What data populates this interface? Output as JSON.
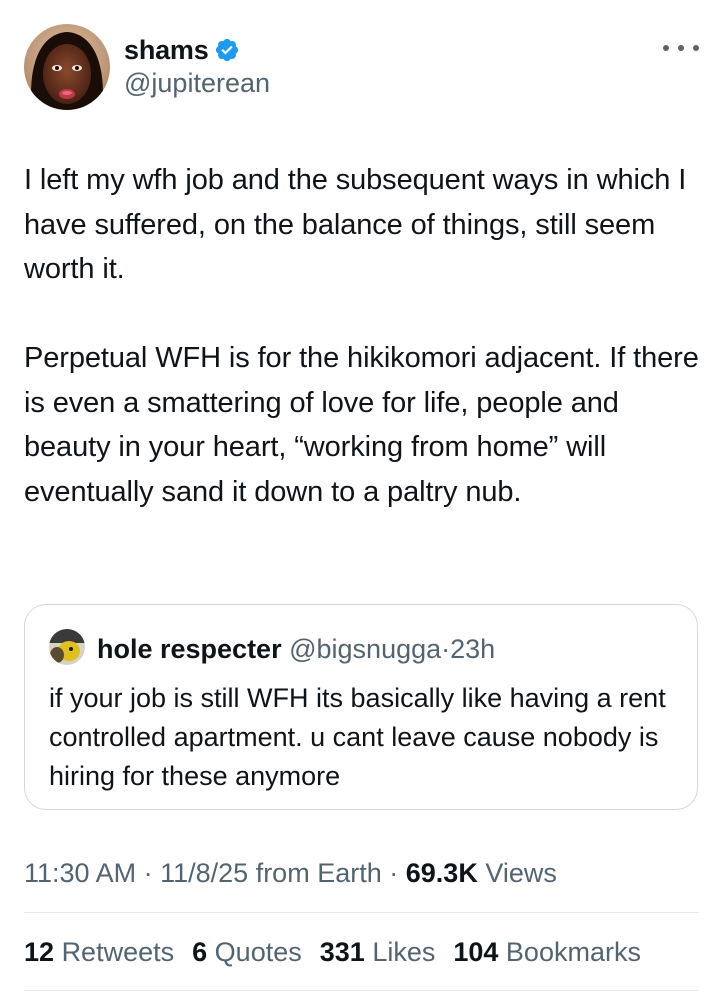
{
  "author": {
    "name": "shams",
    "handle": "@jupiterean",
    "verified": true
  },
  "tweet": {
    "paragraphs": [
      "I left my wfh job and the subsequent ways in which I have suffered, on the balance of things, still seem worth it.",
      "Perpetual WFH is for the hikikomori adjacent. If there is even a smattering of love for life, people and beauty in your heart, “working from home” will eventually sand it down to a paltry nub."
    ]
  },
  "quote": {
    "name": "hole respecter",
    "handle": "@bigsnugga",
    "separator": "·",
    "time": "23h",
    "text": "if your job is still WFH its basically like having a rent controlled apartment. u cant leave cause nobody is hiring for these anymore"
  },
  "meta": {
    "time": "11:30 AM",
    "separator": "·",
    "date_source": "11/8/25 from Earth",
    "views_count": "69.3K",
    "views_label": "Views"
  },
  "stats": {
    "retweets_count": "12",
    "retweets_label": "Retweets",
    "quotes_count": "6",
    "quotes_label": "Quotes",
    "likes_count": "331",
    "likes_label": "Likes",
    "bookmarks_count": "104",
    "bookmarks_label": "Bookmarks"
  },
  "colors": {
    "text_primary": "#0f1419",
    "text_secondary": "#536471",
    "verified_blue": "#1d9bf0",
    "border": "#cfd9de"
  },
  "icons": {
    "verified": "verified-badge-icon",
    "more": "more-horizontal-icon"
  }
}
